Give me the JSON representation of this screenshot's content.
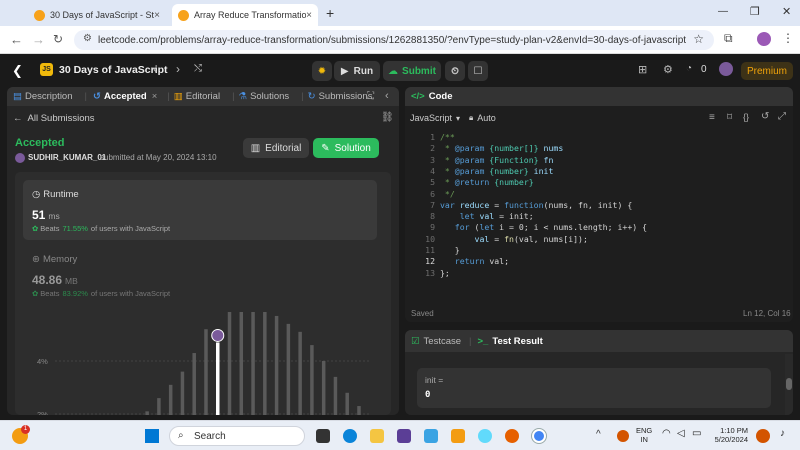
{
  "browser": {
    "tabs": [
      {
        "title": "30 Days of JavaScript - Study Pl",
        "active": false
      },
      {
        "title": "Array Reduce Transformation -",
        "active": true
      }
    ],
    "url": "leetcode.com/problems/array-reduce-transformation/submissions/1262881350/?envType=study-plan-v2&envId=30-days-of-javascript",
    "new_tab": "+",
    "win_min": "—",
    "win_max": "❐",
    "win_close": "✕"
  },
  "header": {
    "study_plan": "30 Days of JavaScript",
    "run_label": "Run",
    "submit_label": "Submit",
    "streak_count": "0",
    "premium_label": "Premium"
  },
  "left_tabs": [
    {
      "label": "Description"
    },
    {
      "label": "Accepted"
    },
    {
      "label": "Editorial"
    },
    {
      "label": "Solutions"
    },
    {
      "label": "Submissions"
    }
  ],
  "submission": {
    "back_label": "All Submissions",
    "status": "Accepted",
    "user": "SUDHIR_KUMAR_01",
    "submitted_text": "submitted at May 20, 2024 13:10",
    "editorial_btn": "Editorial",
    "solution_btn": "Solution",
    "runtime_title": "Runtime",
    "runtime_value": "51",
    "runtime_unit": "ms",
    "runtime_beats": "Beats",
    "runtime_pct": "71.55%",
    "runtime_suffix": "of users with JavaScript",
    "memory_title": "Memory",
    "memory_value": "48.86",
    "memory_unit": "MB",
    "memory_beats": "Beats",
    "memory_pct": "83.92%",
    "memory_suffix": "of users with JavaScript"
  },
  "chart_data": {
    "type": "bar",
    "y_ticks": [
      "8%",
      "6%",
      "4%",
      "2%"
    ],
    "ylim": [
      0,
      8
    ],
    "values": [
      0.1,
      0.2,
      0.4,
      0.7,
      1,
      1.3,
      1.7,
      2.1,
      2.6,
      3.1,
      3.6,
      4.3,
      5.2,
      4.7,
      5.9,
      6.0,
      6.0,
      5.9,
      5.7,
      5.4,
      5.1,
      4.6,
      4.0,
      3.4,
      2.8,
      2.3
    ],
    "highlight_index": 13,
    "highlight_value": 4.7
  },
  "code_panel": {
    "title": "Code",
    "language": "JavaScript",
    "mode": "Auto",
    "saved": "Saved",
    "cursor": "Ln 12, Col 16",
    "lines": [
      [
        {
          "t": "/**",
          "c": "cm"
        }
      ],
      [
        {
          "t": " * ",
          "c": "cm"
        },
        {
          "t": "@param",
          "c": "kw"
        },
        {
          "t": " {number[]} ",
          "c": "ty"
        },
        {
          "t": "nums",
          "c": "id"
        }
      ],
      [
        {
          "t": " * ",
          "c": "cm"
        },
        {
          "t": "@param",
          "c": "kw"
        },
        {
          "t": " {Function} ",
          "c": "ty"
        },
        {
          "t": "fn",
          "c": "id"
        }
      ],
      [
        {
          "t": " * ",
          "c": "cm"
        },
        {
          "t": "@param",
          "c": "kw"
        },
        {
          "t": " {number} ",
          "c": "ty"
        },
        {
          "t": "init",
          "c": "id"
        }
      ],
      [
        {
          "t": " * ",
          "c": "cm"
        },
        {
          "t": "@return",
          "c": "kw"
        },
        {
          "t": " {number}",
          "c": "ty"
        }
      ],
      [
        {
          "t": " */",
          "c": "cm"
        }
      ],
      [
        {
          "t": "var ",
          "c": "kw"
        },
        {
          "t": "reduce",
          "c": "id"
        },
        {
          "t": " = ",
          "c": "op"
        },
        {
          "t": "function",
          "c": "kw"
        },
        {
          "t": "(nums, fn, init) {",
          "c": "op"
        }
      ],
      [
        {
          "t": "    ",
          "c": "op"
        },
        {
          "t": "let ",
          "c": "kw"
        },
        {
          "t": "val",
          "c": "id"
        },
        {
          "t": " = init;",
          "c": "op"
        }
      ],
      [
        {
          "t": "   ",
          "c": "op"
        },
        {
          "t": "for ",
          "c": "kw"
        },
        {
          "t": "(",
          "c": "op"
        },
        {
          "t": "let ",
          "c": "kw"
        },
        {
          "t": "i = 0; i < nums.length; i++) {",
          "c": "op"
        }
      ],
      [
        {
          "t": "       ",
          "c": "op"
        },
        {
          "t": "val",
          "c": "id"
        },
        {
          "t": " = ",
          "c": "op"
        },
        {
          "t": "fn",
          "c": "fn"
        },
        {
          "t": "(val, nums[i]);",
          "c": "op"
        }
      ],
      [
        {
          "t": "   }",
          "c": "op"
        }
      ],
      [
        {
          "t": "   ",
          "c": "op"
        },
        {
          "t": "return ",
          "c": "kw"
        },
        {
          "t": "val;",
          "c": "op"
        }
      ],
      [
        {
          "t": "};",
          "c": "op"
        }
      ]
    ]
  },
  "result_panel": {
    "tab_testcase": "Testcase",
    "tab_result": "Test Result",
    "label": "init =",
    "value": "0"
  },
  "taskbar": {
    "search_placeholder": "Search",
    "lang_top": "ENG",
    "lang_bottom": "IN",
    "time": "1:10 PM",
    "date": "5/20/2024",
    "notif_count": "1"
  }
}
